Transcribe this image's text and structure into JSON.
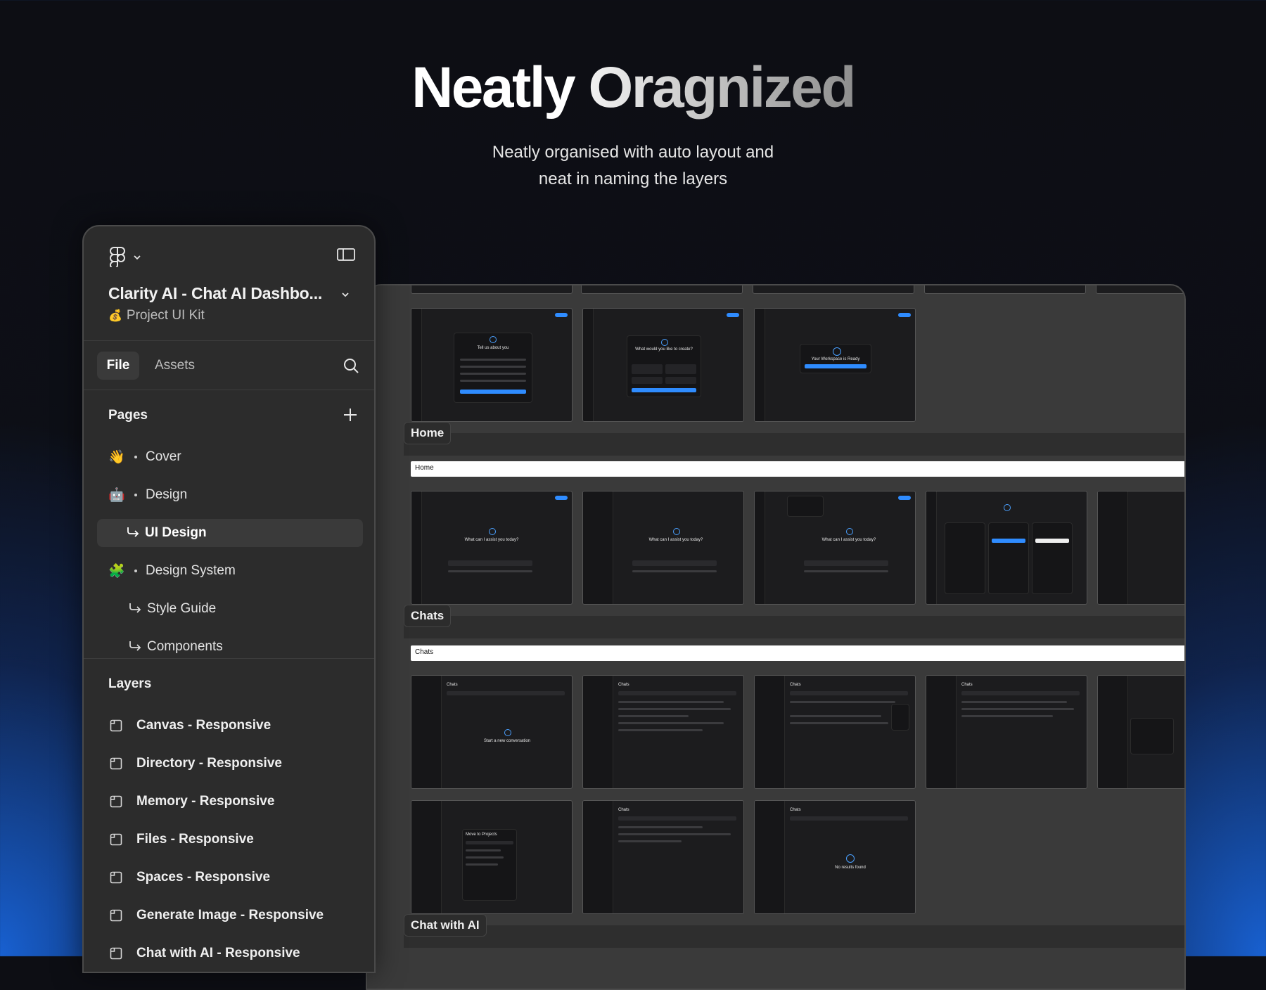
{
  "hero": {
    "title_word1": "Neatly",
    "title_word2": "Oragnized",
    "subtitle_line1": "Neatly organised with auto layout and",
    "subtitle_line2": "neat in naming the layers"
  },
  "sidebar": {
    "project_title": "Clarity AI - Chat AI Dashbo...",
    "project_subtitle": "Project UI Kit",
    "project_emoji": "💰",
    "tabs": {
      "file": "File",
      "assets": "Assets"
    },
    "pages_heading": "Pages",
    "pages": [
      {
        "emoji": "👋",
        "label": "Cover"
      },
      {
        "emoji": "🤖",
        "label": "Design"
      },
      {
        "label": "UI Design",
        "sub": true,
        "active": true
      },
      {
        "emoji": "🧩",
        "label": "Design System"
      },
      {
        "label": "Style Guide",
        "sub": true
      },
      {
        "label": "Components",
        "sub": true
      }
    ],
    "layers_heading": "Layers",
    "layers": [
      "Canvas - Responsive",
      "Directory - Responsive",
      "Memory - Responsive",
      "Files - Responsive",
      "Spaces - Responsive",
      "Generate Image - Responsive",
      "Chat with AI - Responsive"
    ]
  },
  "canvas": {
    "sections": [
      "Home",
      "Chats",
      "Chat with AI"
    ],
    "bars": [
      "Home",
      "Chats"
    ],
    "onboarding": {
      "screen1": "Tell us about you",
      "screen2": "What would you like to create?",
      "screen3": "Your Workspace is Ready"
    },
    "home_screens": {
      "prompt": "What can I assist you today?"
    },
    "chats_screens": {
      "title": "Chats",
      "empty": "Start a new conversation",
      "move": "Move to Projects",
      "no_results": "No results found"
    }
  }
}
